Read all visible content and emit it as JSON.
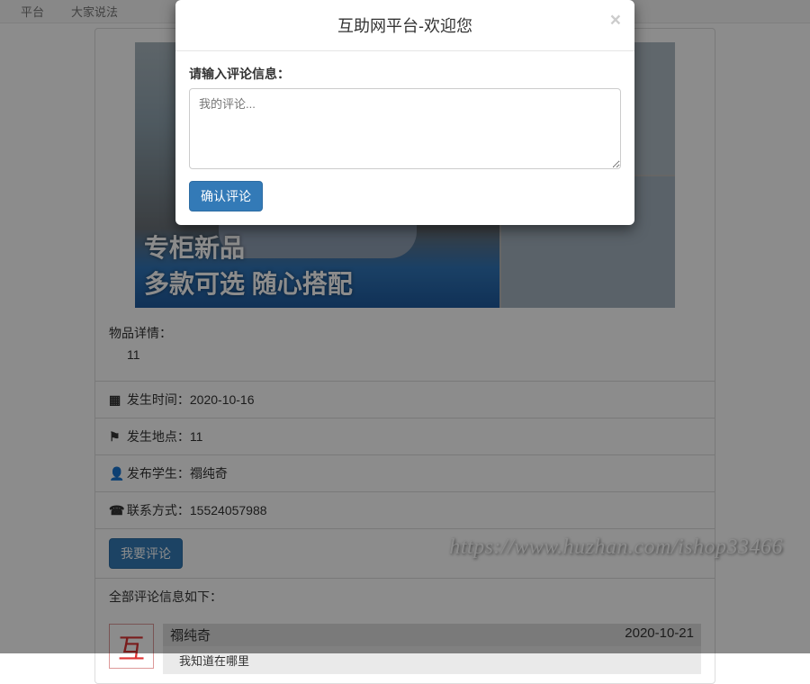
{
  "nav": {
    "item1": "平台",
    "item2": "大家说法"
  },
  "image": {
    "banner_line1": "专柜新品",
    "banner_line2": "多款可选 随心搭配"
  },
  "detail": {
    "label": "物品详情：",
    "value": "11"
  },
  "info": {
    "time_label": "发生时间：",
    "time_value": "2020-10-16",
    "place_label": "发生地点：",
    "place_value": "11",
    "student_label": "发布学生：",
    "student_value": "禤纯奇",
    "contact_label": "联系方式：",
    "contact_value": "15524057988"
  },
  "actions": {
    "comment_btn": "我要评论"
  },
  "comments": {
    "header": "全部评论信息如下：",
    "avatar_char": "互",
    "items": [
      {
        "author": "禤纯奇",
        "date": "2020-10-21",
        "text": "我知道在哪里"
      }
    ]
  },
  "modal": {
    "title": "互助网平台-欢迎您",
    "label": "请输入评论信息：",
    "placeholder": "我的评论...",
    "submit": "确认评论"
  },
  "watermark": "https://www.huzhan.com/ishop33466"
}
